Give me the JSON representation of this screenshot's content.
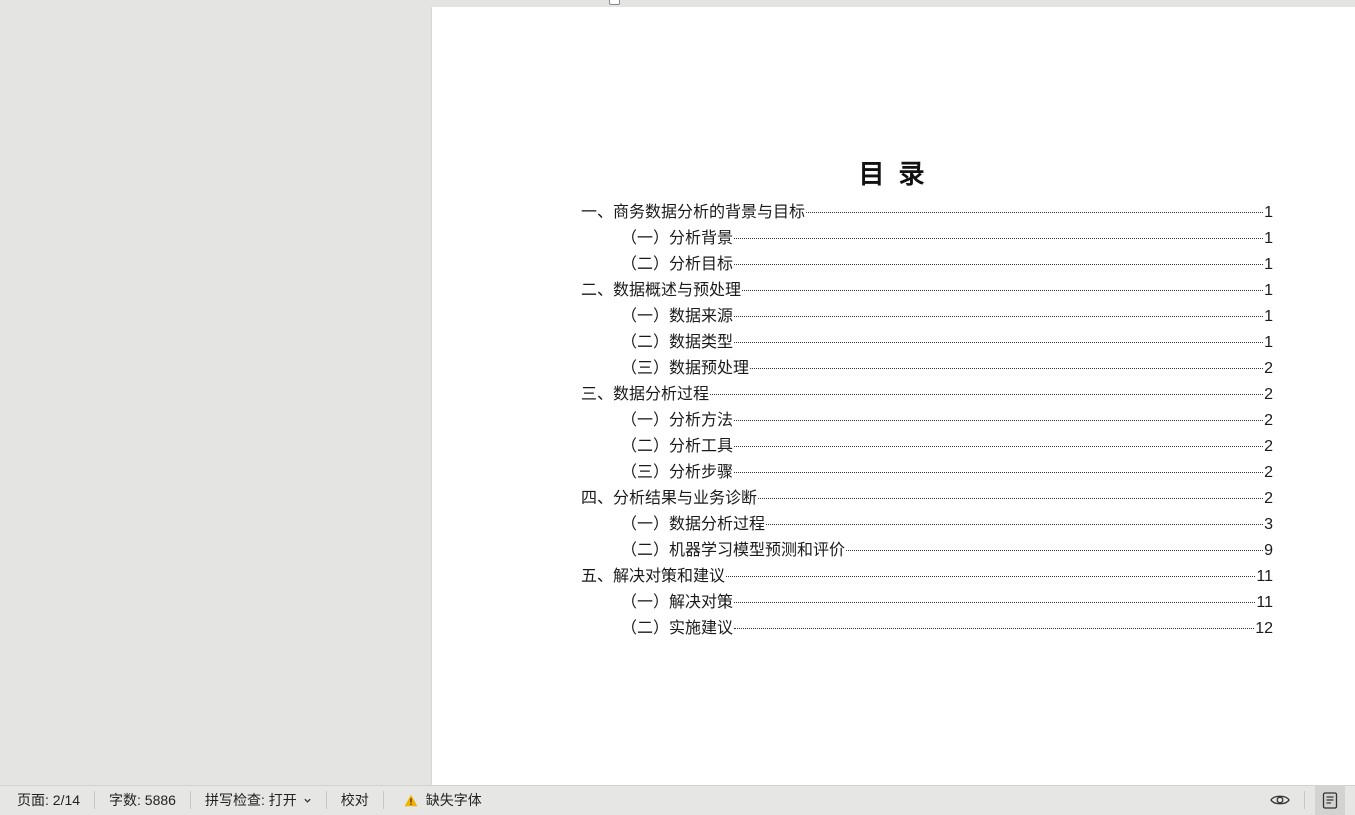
{
  "document": {
    "title": "目录",
    "toc": [
      {
        "level": 1,
        "text": "一、商务数据分析的背景与目标",
        "page": "1"
      },
      {
        "level": 2,
        "text": "（一）分析背景",
        "page": "1"
      },
      {
        "level": 2,
        "text": "（二）分析目标",
        "page": "1"
      },
      {
        "level": 1,
        "text": "二、数据概述与预处理",
        "page": "1"
      },
      {
        "level": 2,
        "text": "（一）数据来源",
        "page": "1"
      },
      {
        "level": 2,
        "text": "（二）数据类型",
        "page": "1"
      },
      {
        "level": 2,
        "text": "（三）数据预处理",
        "page": "2"
      },
      {
        "level": 1,
        "text": "三、数据分析过程",
        "page": "2"
      },
      {
        "level": 2,
        "text": "（一）分析方法",
        "page": "2"
      },
      {
        "level": 2,
        "text": "（二）分析工具",
        "page": "2"
      },
      {
        "level": 2,
        "text": "（三）分析步骤",
        "page": "2"
      },
      {
        "level": 1,
        "text": "四、分析结果与业务诊断",
        "page": "2"
      },
      {
        "level": 2,
        "text": "（一）数据分析过程",
        "page": "3"
      },
      {
        "level": 2,
        "text": "（二）机器学习模型预测和评价",
        "page": "9"
      },
      {
        "level": 1,
        "text": "五、解决对策和建议",
        "page": "11"
      },
      {
        "level": 2,
        "text": "（一）解决对策",
        "page": "11"
      },
      {
        "level": 2,
        "text": "（二）实施建议",
        "page": "12"
      }
    ]
  },
  "statusbar": {
    "page": "页面: 2/14",
    "word_count": "字数: 5886",
    "spell_check": "拼写检查: 打开",
    "proofread": "校对",
    "missing_fonts": "缺失字体"
  },
  "icons": {
    "spell_dropdown": "chevron-down-icon",
    "missing_fonts": "warning-icon",
    "reading_mode": "eye-icon",
    "page_view": "page-layout-icon"
  },
  "colors": {
    "warning": "#f0b400",
    "workspace": "#e4e4e2",
    "statusbar": "#e6e6e4"
  }
}
